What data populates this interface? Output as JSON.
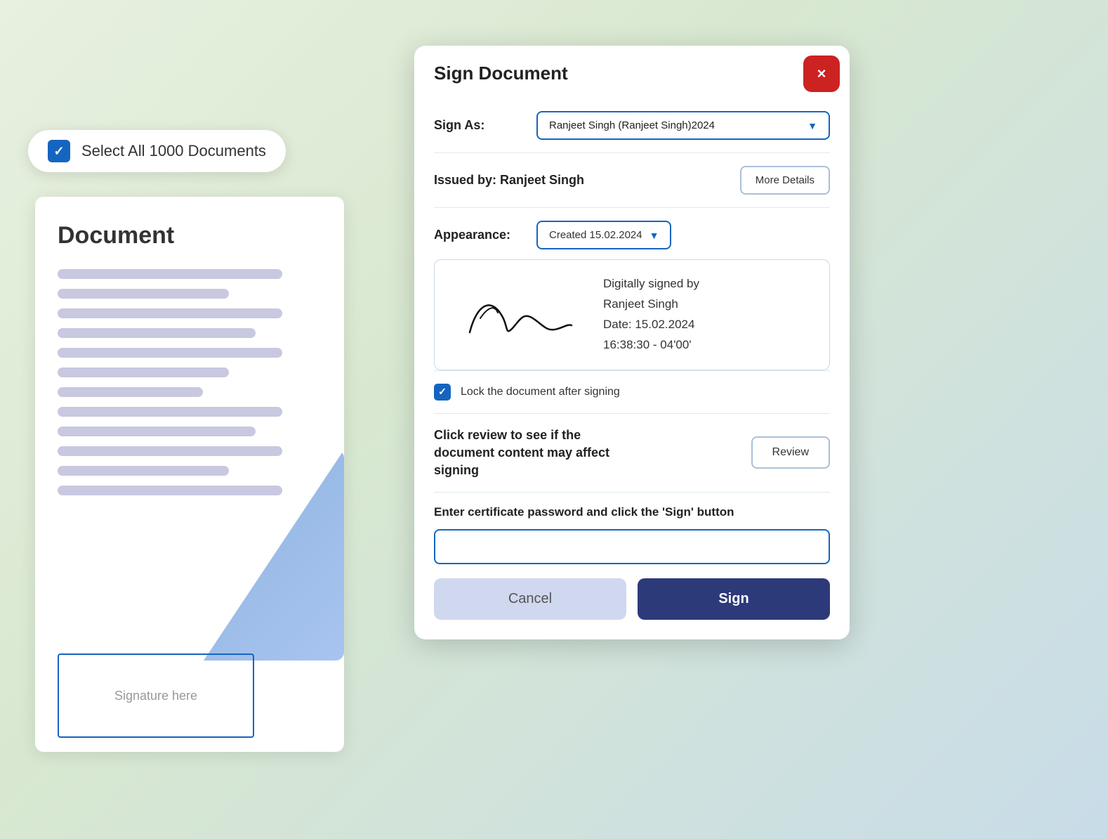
{
  "select_all": {
    "label": "Select All 1000 Documents"
  },
  "document": {
    "title": "Document",
    "signature_placeholder": "Signature here"
  },
  "modal": {
    "title": "Sign Document",
    "close_label": "×",
    "sign_as_label": "Sign As:",
    "sign_as_value": "Ranjeet Singh (Ranjeet Singh)2024",
    "issued_by_label": "Issued by: Ranjeet Singh",
    "more_details_label": "More Details",
    "appearance_label": "Appearance:",
    "appearance_value": "Created 15.02.2024",
    "signature_preview": {
      "digitally_signed_by": "Digitally signed by",
      "signer_name": "Ranjeet Singh",
      "date_label": "Date: 15.02.2024",
      "time_label": "16:38:30 - 04'00'"
    },
    "lock_label": "Lock the document after signing",
    "review_text": "Click review to see if the document content may affect signing",
    "review_btn_label": "Review",
    "password_label": "Enter certificate password and click the 'Sign' button",
    "password_placeholder": "",
    "cancel_label": "Cancel",
    "sign_label": "Sign"
  }
}
